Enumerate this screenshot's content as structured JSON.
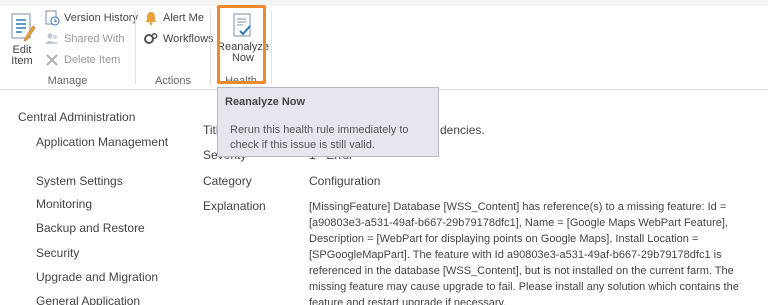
{
  "ribbon": {
    "manage": {
      "label": "Manage",
      "edit_item": "Edit\nItem",
      "version_history": "Version History",
      "shared_with": "Shared With",
      "delete_item": "Delete Item"
    },
    "actions": {
      "label": "Actions",
      "alert_me": "Alert Me",
      "workflows": "Workflows"
    },
    "health": {
      "label": "Health",
      "reanalyze_line1": "Reanalyze",
      "reanalyze_line2": "Now"
    }
  },
  "tooltip": {
    "title": "Reanalyze Now",
    "body": "Rerun this health rule immediately to check if this issue is still valid."
  },
  "nav": {
    "header": "Central Administration",
    "items": [
      "Application Management",
      "System Settings",
      "Monitoring",
      "Backup and Restore",
      "Security",
      "Upgrade and Migration",
      "General Application"
    ]
  },
  "details": {
    "title_label": "Title",
    "title_value": "dencies.",
    "severity_label": "Severity",
    "severity_value": "1 - Error",
    "category_label": "Category",
    "category_value": "Configuration",
    "explanation_label": "Explanation",
    "explanation_value": "[MissingFeature] Database [WSS_Content] has reference(s) to a missing feature: Id = [a90803e3-a531-49af-b667-29b79178dfc1], Name = [Google Maps WebPart Feature], Description = [WebPart for displaying points on Google Maps], Install Location = [SPGoogleMapPart]. The feature with Id a90803e3-a531-49af-b667-29b79178dfc1 is referenced in the database [WSS_Content], but is not installed on the current farm. The missing feature may cause upgrade to fail. Please install any solution which contains the feature and restart upgrade if necessary."
  },
  "colors": {
    "highlight": "#f0892b",
    "tooltip_bg": "#e6e6ee",
    "icon_blue": "#2a7ab8",
    "icon_orange": "#e8a23a"
  }
}
